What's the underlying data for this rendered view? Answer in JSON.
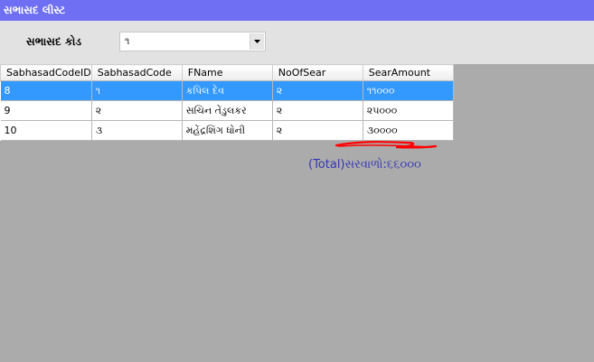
{
  "window": {
    "title": "સભાસદ લીસ્ટ"
  },
  "filter": {
    "label": "સભાસદ કોડ",
    "selected_value": "૧",
    "dropdown_icon": "chevron-down-icon"
  },
  "grid": {
    "columns": [
      "SabhasadCodeID",
      "SabhasadCode",
      "FName",
      "NoOfSear",
      "SearAmount"
    ],
    "rows": [
      {
        "SabhasadCodeID": "8",
        "SabhasadCode": "૧",
        "FName": "કપિલ દેવ",
        "NoOfSear": "૨",
        "SearAmount": "૧૧૦૦૦"
      },
      {
        "SabhasadCodeID": "9",
        "SabhasadCode": "૨",
        "FName": "સચિન તેંડુલકર",
        "NoOfSear": "૨",
        "SearAmount": "૨૫૦૦૦"
      },
      {
        "SabhasadCodeID": "10",
        "SabhasadCode": "૩",
        "FName": "મહેંદ્રશિંગ ધોની",
        "NoOfSear": "૨",
        "SearAmount": "૩૦૦૦૦"
      }
    ],
    "selected_row": 0
  },
  "summary": {
    "total_text": "(Total)સરવાળો:૬૬૦૦૦"
  },
  "colors": {
    "title_bar": "#6f6ff3",
    "selection": "#3399ff",
    "total_text": "#3434b6",
    "annotation_mark": "#ff0000"
  }
}
